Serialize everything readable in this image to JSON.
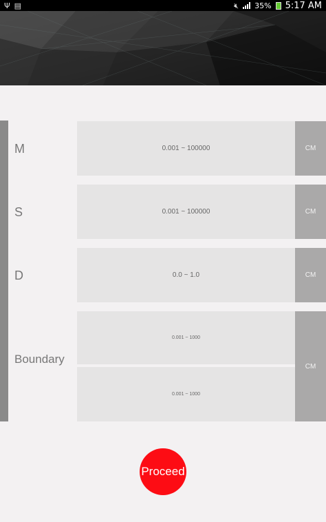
{
  "status_bar": {
    "battery": "35%",
    "time": "5:17 AM"
  },
  "rows": [
    {
      "label": "M",
      "range": "0.001 ~ 100000",
      "unit": "CM"
    },
    {
      "label": "S",
      "range": "0.001 ~ 100000",
      "unit": "CM"
    },
    {
      "label": "D",
      "range": "0.0 ~ 1.0",
      "unit": "CM"
    }
  ],
  "boundary": {
    "label": "Boundary",
    "range_1": "0.001 ~ 1000",
    "range_2": "0.001 ~ 1000",
    "unit": "CM"
  },
  "proceed_label": "Proceed",
  "colors": {
    "accent": "#fd0c14",
    "unit_bg": "#aaa9a9",
    "field_bg": "#e5e4e4"
  }
}
